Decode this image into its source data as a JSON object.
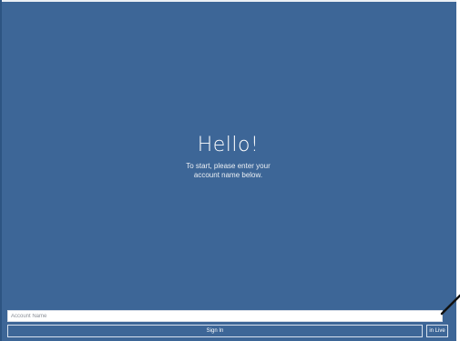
{
  "greeting": {
    "title": "Hello!",
    "subtitle_line1": "To start, please enter your",
    "subtitle_line2": "account name below."
  },
  "form": {
    "account_placeholder": "Account Name",
    "signin_label": "Sign In",
    "live_label": "in Live"
  },
  "colors": {
    "background": "#3d6697",
    "text": "#ffffff"
  }
}
